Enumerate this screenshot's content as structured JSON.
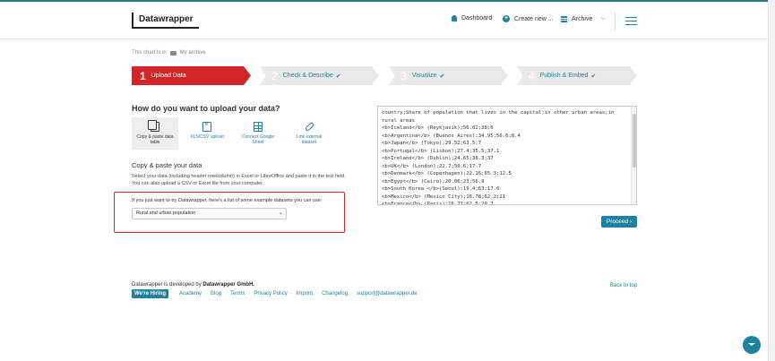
{
  "header": {
    "logo": "Datawrapper",
    "nav": [
      {
        "label": "Dashboard",
        "icon": "bell-icon"
      },
      {
        "label": "Create new ...",
        "icon": "plus-circle-icon"
      },
      {
        "label": "Archive",
        "icon": "archive-icon"
      }
    ]
  },
  "breadcrumb": {
    "prefix": "This chart is in",
    "folder": "My archive"
  },
  "steps": [
    {
      "num": "1",
      "label": "Upload Data",
      "active": true
    },
    {
      "num": "2",
      "label": "Check & Describe",
      "done": true
    },
    {
      "num": "3",
      "label": "Visualize",
      "done": true
    },
    {
      "num": "4",
      "label": "Publish & Embed",
      "done": true
    }
  ],
  "upload": {
    "title": "How do you want to upload your data?",
    "options": [
      {
        "line1": "Copy & paste data",
        "line2": "table",
        "selected": true
      },
      {
        "line1": "XLS/CSV upload",
        "line2": ""
      },
      {
        "line1": "Connect Google",
        "line2": "Sheet"
      },
      {
        "line1": "Link external",
        "line2": "dataset"
      }
    ]
  },
  "paste": {
    "title": "Copy & paste your data",
    "desc": "Select your data (including header row/column) in Excel or LibreOffice and paste it in the text field. You can also upload a CSV or Excel file from your computer.",
    "example_label": "If you just want to try Datawrapper, here's a list of some example datasets you can use:",
    "example_selected": "Rural and urban population"
  },
  "data_text": "country;Share of population that lives in the capital;in other urban areas;in\nrural areas\n<b>Iceland</b> (Reykjavík);56.02;38;6\n<b>Argentina</b> (Buenos Aires);34.95;56.6;8.4\n<b>Japan</b> (Tokyo);29.52;63.5;7\n<b>Portugal</b> (Lisbon);27.4;35.5;37.1\n<b>Ireland</b> (Dublin);24.65;38.3;37\n<b>UK</b> (London);22.7;59.6;17.7\n<b>Denmark</b> (Copenhagen);22.16;65.3;12.5\n<b>Egypt</b> (Cairo);20.06;23;56.9\n<b>South Korea </b>(Seoul);19.4;63;17.6\n<b>Mexico</b> (Mexico City);16.78;62.2;21\n<b>France</b> (Paris);16.77;62.5;20.7",
  "proceed_label": "Proceed",
  "footer": {
    "dev_prefix": "Datawrapper is developed by",
    "dev_company": "Datawrapper GmbH.",
    "hiring": "We're Hiring",
    "links": [
      "Academy",
      "Blog",
      "Terms",
      "Privacy Policy",
      "Imprint",
      "Changelog",
      "support@datawrapper.de"
    ],
    "back_to_top": "Back to top"
  }
}
